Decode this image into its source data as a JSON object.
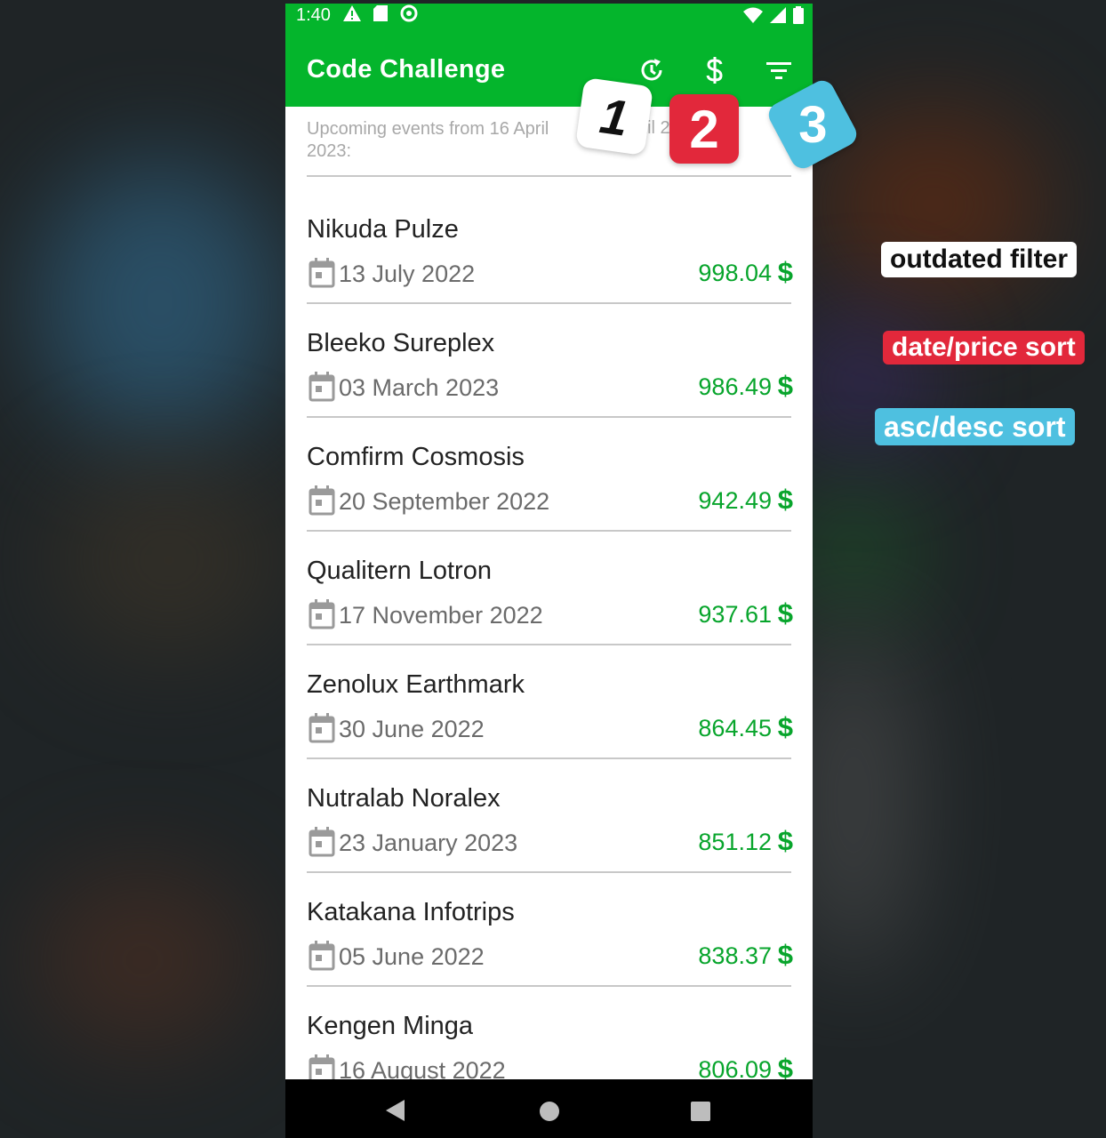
{
  "status_bar": {
    "time": "1:40"
  },
  "app_bar": {
    "title": "Code Challenge",
    "actions": [
      "history-icon",
      "dollar-icon",
      "filter-list-icon"
    ]
  },
  "subtitle": {
    "line": "Upcoming events from 16 April 2023:",
    "tail": "ıtil 2"
  },
  "events": [
    {
      "name": "Nikuda Pulze",
      "date": "13 July 2022",
      "price": "998.04",
      "currency": "$"
    },
    {
      "name": "Bleeko Sureplex",
      "date": "03 March 2023",
      "price": "986.49",
      "currency": "$"
    },
    {
      "name": "Comfirm Cosmosis",
      "date": "20 September 2022",
      "price": "942.49",
      "currency": "$"
    },
    {
      "name": "Qualitern Lotron",
      "date": "17 November 2022",
      "price": "937.61",
      "currency": "$"
    },
    {
      "name": "Zenolux Earthmark",
      "date": "30 June 2022",
      "price": "864.45",
      "currency": "$"
    },
    {
      "name": "Nutralab Noralex",
      "date": "23 January 2023",
      "price": "851.12",
      "currency": "$"
    },
    {
      "name": "Katakana Infotrips",
      "date": "05 June 2022",
      "price": "838.37",
      "currency": "$"
    },
    {
      "name": "Kengen Minga",
      "date": "16 August 2022",
      "price": "806.09",
      "currency": "$"
    }
  ],
  "stickers": {
    "one": "1",
    "two": "2",
    "three": "3"
  },
  "annotations": {
    "outdated": "outdated filter",
    "date_price": "date/price sort",
    "asc_desc": "asc/desc sort"
  },
  "colors": {
    "accent": "#04b52c",
    "price": "#08a52c",
    "sticker_red": "#e2283b",
    "sticker_blue": "#4ec0e0"
  }
}
